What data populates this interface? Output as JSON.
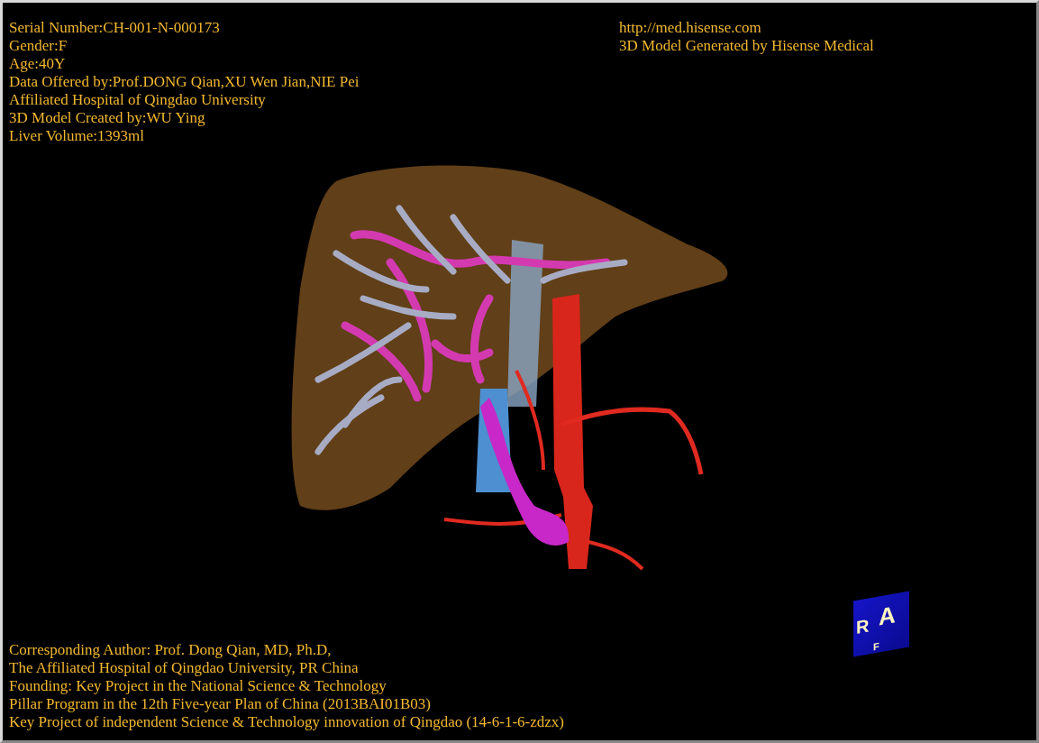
{
  "info_left": [
    "Serial Number:CH-001-N-000173",
    "Gender:F",
    "Age:40Y",
    "Data Offered by:Prof.DONG Qian,XU Wen Jian,NIE Pei",
    "Affiliated Hospital of Qingdao University",
    "3D Model Created by:WU Ying",
    "Liver Volume:1393ml"
  ],
  "info_right": [
    "http://med.hisense.com",
    "3D Model Generated by Hisense Medical"
  ],
  "credits": [
    "Corresponding Author: Prof. Dong Qian, MD, Ph.D,",
    "The Affiliated Hospital of Qingdao University, PR China",
    "Founding: Key Project in the National Science & Technology",
    "Pillar Program in the 12th Five-year Plan of China (2013BAI01B03)",
    "Key Project of independent Science & Technology innovation of Qingdao (14-6-1-6-zdzx)"
  ],
  "orientation_cube": {
    "letters": [
      {
        "kind": "left",
        "text": "R"
      },
      {
        "kind": "front",
        "text": "A"
      },
      {
        "kind": "bottom",
        "text": "F"
      }
    ]
  }
}
